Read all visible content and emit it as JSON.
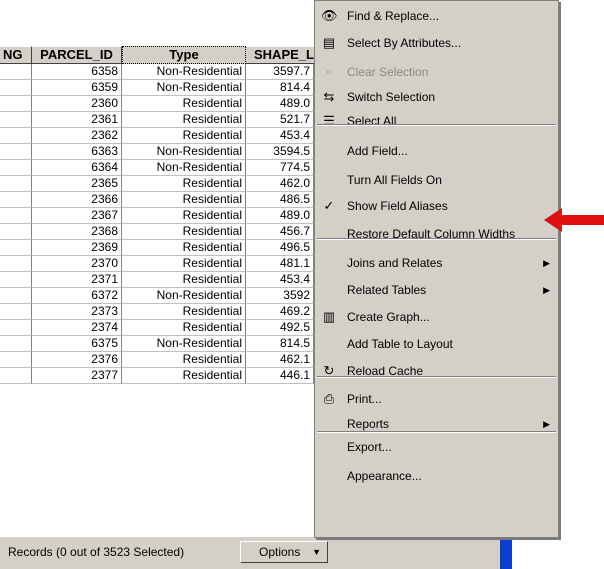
{
  "table": {
    "headers": [
      "NG",
      "PARCEL_ID",
      "Type",
      "SHAPE_L"
    ],
    "rows": [
      [
        "6358",
        "Non-Residential",
        "3597.7"
      ],
      [
        "6359",
        "Non-Residential",
        "814.4"
      ],
      [
        "2360",
        "Residential",
        "489.0"
      ],
      [
        "2361",
        "Residential",
        "521.7"
      ],
      [
        "2362",
        "Residential",
        "453.4"
      ],
      [
        "6363",
        "Non-Residential",
        "3594.5"
      ],
      [
        "6364",
        "Non-Residential",
        "774.5"
      ],
      [
        "2365",
        "Residential",
        "462.0"
      ],
      [
        "2366",
        "Residential",
        "486.5"
      ],
      [
        "2367",
        "Residential",
        "489.0"
      ],
      [
        "2368",
        "Residential",
        "456.7"
      ],
      [
        "2369",
        "Residential",
        "496.5"
      ],
      [
        "2370",
        "Residential",
        "481.1"
      ],
      [
        "2371",
        "Residential",
        "453.4"
      ],
      [
        "6372",
        "Non-Residential",
        "3592"
      ],
      [
        "2373",
        "Residential",
        "469.2"
      ],
      [
        "2374",
        "Residential",
        "492.5"
      ],
      [
        "6375",
        "Non-Residential",
        "814.5"
      ],
      [
        "2376",
        "Residential",
        "462.1"
      ],
      [
        "2377",
        "Residential",
        "446.1"
      ]
    ]
  },
  "status": {
    "records": "Records (0 out of 3523 Selected)",
    "options": "Options"
  },
  "menu": {
    "items": [
      {
        "label": "Find & Replace...",
        "icon": "binoculars-icon",
        "glyph": "👁",
        "disabled": false,
        "submenu": false,
        "checked": false
      },
      {
        "label": "Select By Attributes...",
        "icon": "sql-select-icon",
        "glyph": "▤",
        "disabled": false,
        "submenu": false,
        "checked": false
      },
      {
        "label": "Clear Selection",
        "icon": "clear-selection-icon",
        "glyph": "▫",
        "disabled": true,
        "submenu": false,
        "checked": false
      },
      {
        "label": "Switch Selection",
        "icon": "switch-selection-icon",
        "glyph": "⇆",
        "disabled": false,
        "submenu": false,
        "checked": false
      },
      {
        "label": "Select All",
        "icon": "select-all-icon",
        "glyph": "☰",
        "disabled": false,
        "submenu": false,
        "checked": false
      },
      {
        "label": "Add Field...",
        "icon": "",
        "glyph": "",
        "disabled": false,
        "submenu": false,
        "checked": false
      },
      {
        "label": "Turn All Fields On",
        "icon": "",
        "glyph": "",
        "disabled": false,
        "submenu": false,
        "checked": false
      },
      {
        "label": "Show Field Aliases",
        "icon": "check-icon",
        "glyph": "✓",
        "disabled": false,
        "submenu": false,
        "checked": true
      },
      {
        "label": "Restore Default Column Widths",
        "icon": "",
        "glyph": "",
        "disabled": false,
        "submenu": false,
        "checked": false
      },
      {
        "label": "Joins and Relates",
        "icon": "",
        "glyph": "",
        "disabled": false,
        "submenu": true,
        "checked": false
      },
      {
        "label": "Related Tables",
        "icon": "",
        "glyph": "",
        "disabled": false,
        "submenu": true,
        "checked": false
      },
      {
        "label": "Create Graph...",
        "icon": "graph-icon",
        "glyph": "▥",
        "disabled": false,
        "submenu": false,
        "checked": false
      },
      {
        "label": "Add Table to Layout",
        "icon": "",
        "glyph": "",
        "disabled": false,
        "submenu": false,
        "checked": false
      },
      {
        "label": "Reload Cache",
        "icon": "reload-icon",
        "glyph": "↻",
        "disabled": false,
        "submenu": false,
        "checked": false
      },
      {
        "label": "Print...",
        "icon": "printer-icon",
        "glyph": "⎙",
        "disabled": false,
        "submenu": false,
        "checked": false
      },
      {
        "label": "Reports",
        "icon": "",
        "glyph": "",
        "disabled": false,
        "submenu": true,
        "checked": false
      },
      {
        "label": "Export...",
        "icon": "",
        "glyph": "",
        "disabled": false,
        "submenu": false,
        "checked": false
      },
      {
        "label": "Appearance...",
        "icon": "",
        "glyph": "",
        "disabled": false,
        "submenu": false,
        "checked": false
      }
    ]
  },
  "colors": {
    "title_bar": "#0a4fd6",
    "menu_bg": "#d4d0c8",
    "arrow": "#e01010"
  }
}
